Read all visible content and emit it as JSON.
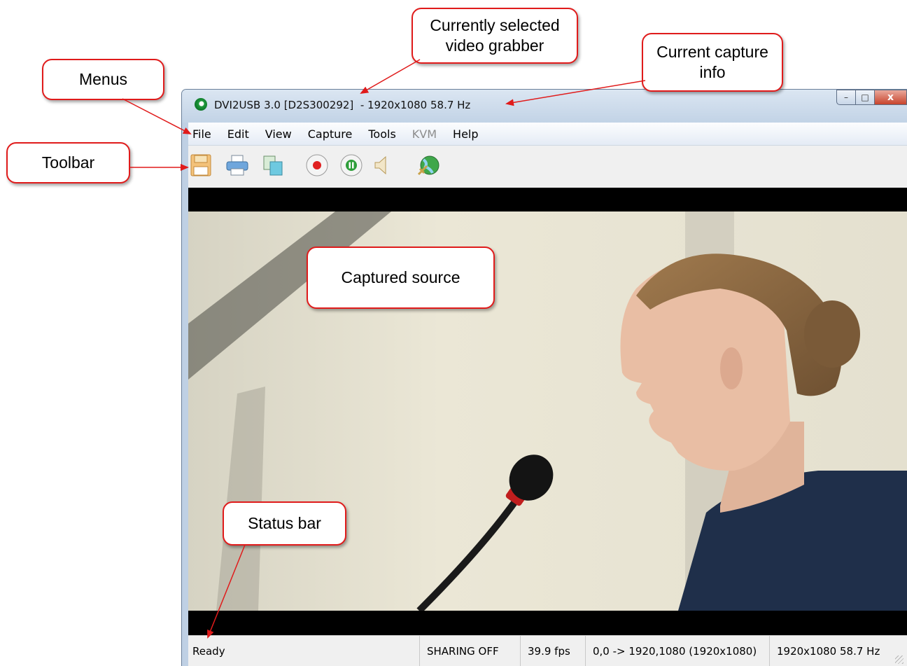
{
  "window": {
    "title": "DVI2USB 3.0 [D2S300292]  - 1920x1080 58.7 Hz",
    "controls": {
      "minimize": "–",
      "maximize": "□",
      "close": "x"
    }
  },
  "menubar": {
    "items": [
      {
        "label": "File",
        "enabled": true
      },
      {
        "label": "Edit",
        "enabled": true
      },
      {
        "label": "View",
        "enabled": true
      },
      {
        "label": "Capture",
        "enabled": true
      },
      {
        "label": "Tools",
        "enabled": true
      },
      {
        "label": "KVM",
        "enabled": false
      },
      {
        "label": "Help",
        "enabled": true
      }
    ]
  },
  "toolbar": {
    "buttons": [
      "save-icon",
      "print-icon",
      "copy-icon",
      "record-icon",
      "pause-icon",
      "speaker-icon",
      "sharing-globe-icon"
    ]
  },
  "statusbar": {
    "ready": "Ready",
    "sharing": "SHARING OFF",
    "fps": "39.9 fps",
    "region": "0,0 -> 1920,1080 (1920x1080)",
    "mode": "1920x1080 58.7 Hz"
  },
  "callouts": {
    "menus": "Menus",
    "grabber_line1": "Currently selected",
    "grabber_line2": "video grabber",
    "capture_info_line1": "Current capture",
    "capture_info_line2": "info",
    "toolbar": "Toolbar",
    "captured_source": "Captured source",
    "status_bar": "Status bar"
  },
  "colors": {
    "callout_border": "#e01b1b",
    "arrow": "#e01b1b",
    "record": "#e02020",
    "pause": "#2e9e3a"
  }
}
